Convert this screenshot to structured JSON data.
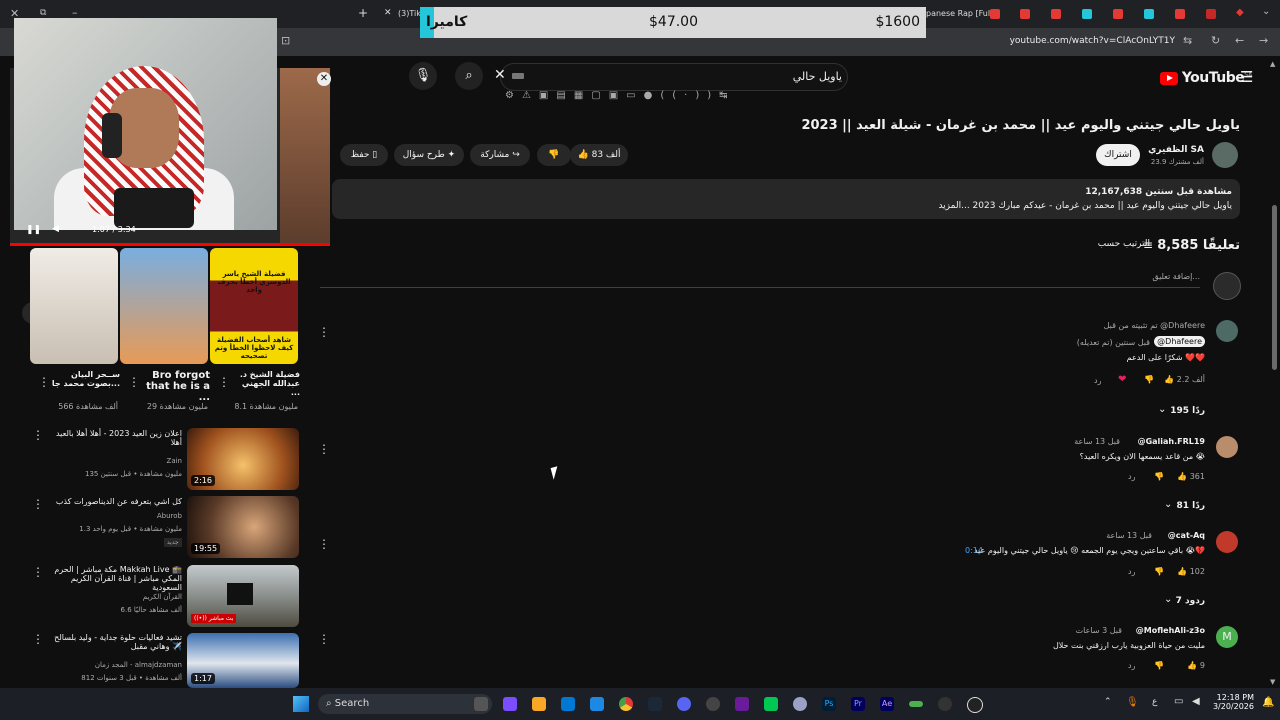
{
  "browser": {
    "tab_label": "(3)Tik",
    "tab_label_2": "panese Rap [Full",
    "url": "youtube.com/watch?v=ClAcOnLYT1Y"
  },
  "donation": {
    "label": "كاميرا",
    "price": "$47.00",
    "goal": "$1600"
  },
  "miniplayer": {
    "time": "1:07 / 3:34"
  },
  "header": {
    "search_value": "ياويل حالي",
    "logo_text": "YouTube",
    "region": "SA"
  },
  "video": {
    "title": "ياويل حالي جيتني واليوم عيد || محمد بن غرمان - شيلة العيد || 2023",
    "channel": "الظفيري SA",
    "subs": "23.9 ألف مشترك",
    "subscribe": "اشتراك",
    "likes": "83 ألف",
    "share": "مشاركة",
    "ask": "طرح سؤال",
    "save": "حفظ",
    "views": "12,167,638 مشاهدة  قبل سنتين",
    "desc": "ياويل حالي جيتني واليوم عيد || محمد بن غرمان - عيدكم مبارك 2023 ...المزيد"
  },
  "comments": {
    "count": "8,585 تعليقًا",
    "sort": "الترتيب حسب",
    "add_placeholder": "إضافة تعليق...",
    "items": [
      {
        "pinned": "تم تثبيته من قبل @Dhafeere",
        "user": "@Dhafeere",
        "time": "قبل سنتين (تم تعديله)",
        "text": "شكرًا على الدعم ❤️❤️",
        "likes": "2.2 ألف",
        "reply": "رد",
        "replies": "195 ردًا"
      },
      {
        "user": "@Galiah.FRL19",
        "time": "قبل 13 ساعة",
        "text": "من قاعد يسمعها الان ويكره العيد؟ 😭",
        "likes": "361",
        "reply": "رد",
        "replies": "81 ردًا"
      },
      {
        "user": "@cat-Aq",
        "time": "قبل 13 ساعة",
        "text": "باقي ساعتين ويجي يوم الجمعه 😢 ياويل حالي جيتني واليوم عيد 😭💔",
        "timestamp": "0:14",
        "likes": "102",
        "reply": "رد",
        "replies": "7 ردود"
      },
      {
        "user": "@MoflehAli-z3o",
        "time": "قبل 3 ساعات",
        "text": "مليت من حياة العزوبية يارب ارزقني بنت حلال",
        "likes": "9",
        "reply": "رد",
        "avatar_letter": "M"
      }
    ]
  },
  "shorts": [
    {
      "title": "ســحر البيان بصوت محمد جا...",
      "views": "566 ألف مشاهدة"
    },
    {
      "title": "Bro forgot that he is a ...",
      "views": "29 مليون مشاهدة"
    },
    {
      "title": "فضيلة الشيخ د. عبدالله الجهني ...",
      "views": "8.1 مليون مشاهدة",
      "overlay_top": "فضيلة الشيخ ياسر الدوسري أخطأ بحرف واحد",
      "overlay_bottom": "شاهد أصحاب الفضيلة كيف لاحظوا الخطأ وتم تصحيحه"
    }
  ],
  "related": [
    {
      "title": "اعلان زين العيد 2023 - أهلا أهلا بالعيد أهلا",
      "channel": "Zain",
      "meta": "135 مليون مشاهدة • قبل سنتين",
      "duration": "2:16"
    },
    {
      "title": "كل اشي بتعرفه عن الديناصورات كذب",
      "channel": "Aburob",
      "meta": "1.3 مليون مشاهدة • قبل يوم واحد",
      "badge": "جديد",
      "duration": "19:55"
    },
    {
      "title": "مكة مباشر | الحرم Makkah Live 🕋 المكي مباشر | قناة القرآن الكريم السعودية",
      "channel": "القرآن الكريم",
      "meta": "6.6 ألف مشاهد حاليًا",
      "badge": "((•)) بث مباشر"
    },
    {
      "title": "تشيد فعاليات حلوة جداية - وليد بلسالح وهاني مقبل ✈️",
      "channel": "المجد زمان - almajdzaman",
      "meta": "812 ألف مشاهدة • قبل 3 سنوات",
      "duration": "1:17"
    }
  ],
  "taskbar": {
    "search": "Search",
    "time": "12:18 PM",
    "date": "3/20/2026"
  }
}
